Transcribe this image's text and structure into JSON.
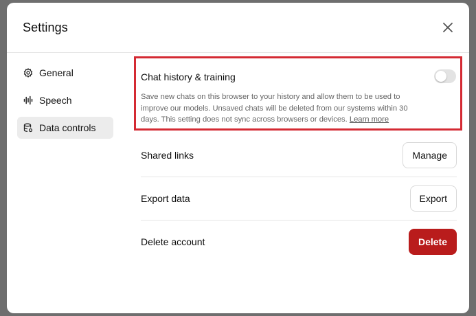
{
  "dialog": {
    "title": "Settings",
    "close_icon": "close-icon"
  },
  "sidebar": {
    "items": [
      {
        "label": "General",
        "icon": "gear-icon",
        "active": false
      },
      {
        "label": "Speech",
        "icon": "waveform-icon",
        "active": false
      },
      {
        "label": "Data controls",
        "icon": "database-icon",
        "active": true
      }
    ]
  },
  "chat_history": {
    "title": "Chat history & training",
    "enabled": false,
    "description": "Save new chats on this browser to your history and allow them to be used to improve our models. Unsaved chats will be deleted from our systems within 30 days. This setting does not sync across browsers or devices.",
    "learn_more": "Learn more"
  },
  "rows": [
    {
      "label": "Shared links",
      "button": "Manage",
      "style": "default"
    },
    {
      "label": "Export data",
      "button": "Export",
      "style": "default"
    },
    {
      "label": "Delete account",
      "button": "Delete",
      "style": "danger"
    }
  ],
  "colors": {
    "highlight": "#d42a33",
    "danger": "#b91c1c",
    "active_nav": "#ececec"
  }
}
